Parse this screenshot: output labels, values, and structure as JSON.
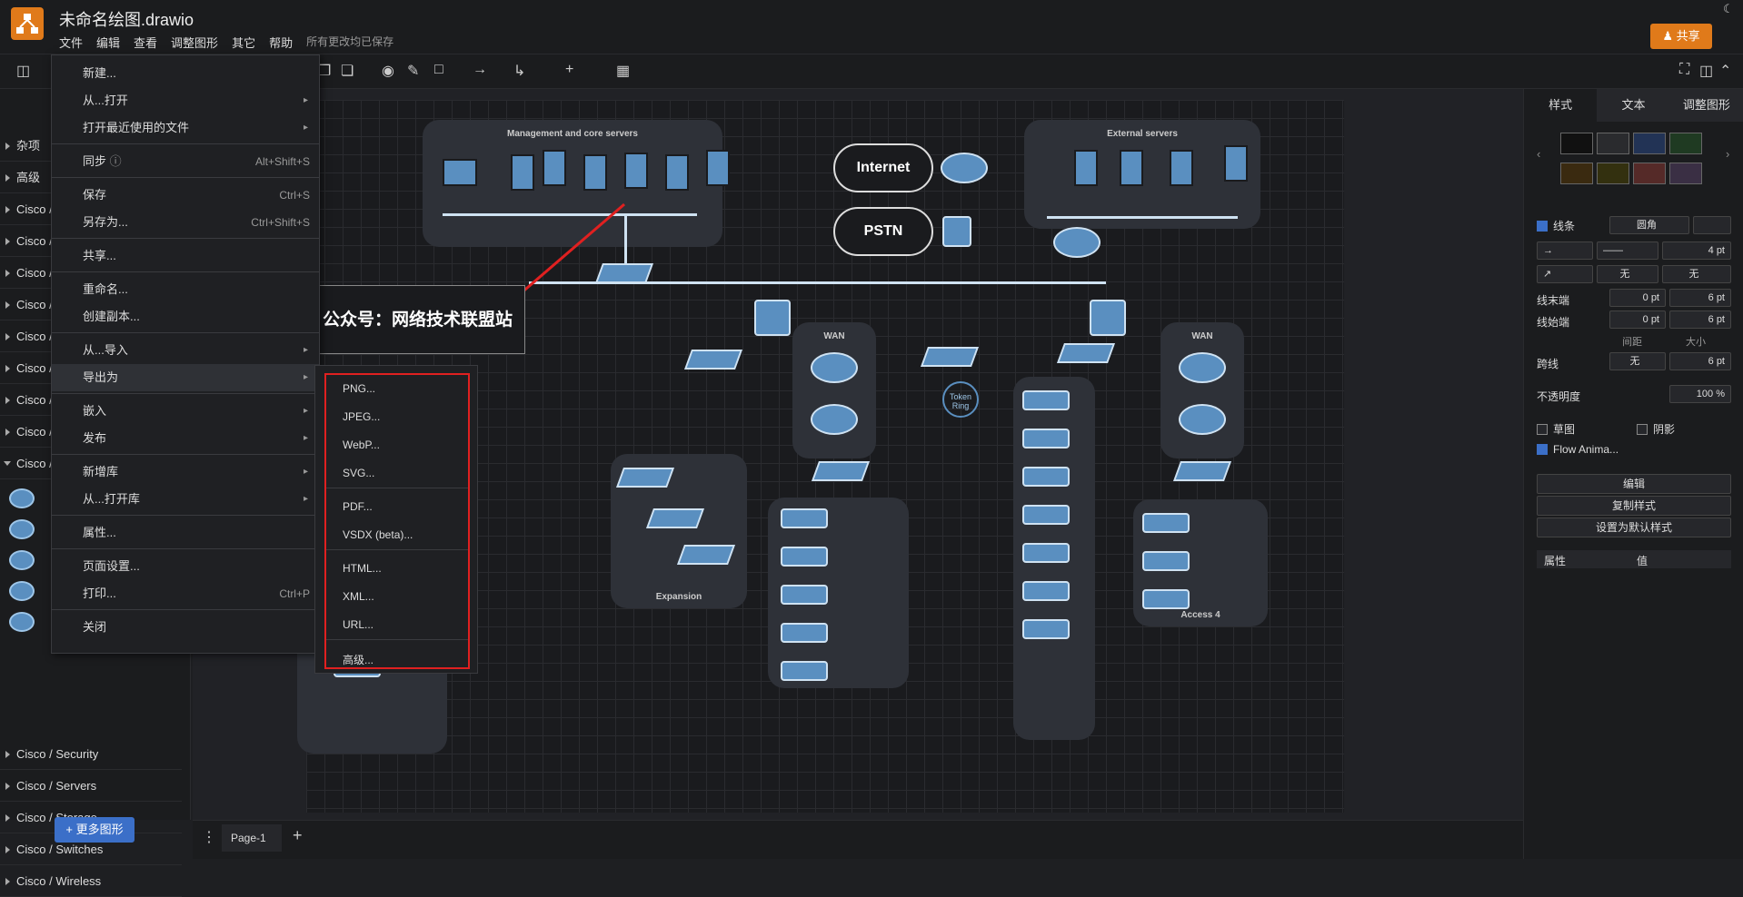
{
  "app": {
    "title": "未命名绘图.drawio",
    "menus": [
      "文件",
      "编辑",
      "查看",
      "调整图形",
      "其它",
      "帮助"
    ],
    "saved_status": "所有更改均已保存",
    "share_label": "共享"
  },
  "sidebar": {
    "items": [
      {
        "label": "杂项",
        "open": false
      },
      {
        "label": "高级",
        "open": false
      },
      {
        "label": "Cisco /",
        "open": false
      },
      {
        "label": "Cisco /",
        "open": false
      },
      {
        "label": "Cisco /",
        "open": false
      },
      {
        "label": "Cisco /",
        "open": false
      },
      {
        "label": "Cisco /",
        "open": false
      },
      {
        "label": "Cisco /",
        "open": false
      },
      {
        "label": "Cisco /",
        "open": false
      },
      {
        "label": "Cisco /",
        "open": false
      },
      {
        "label": "Cisco /",
        "open": true
      }
    ],
    "bottom_items": [
      "Cisco / Security",
      "Cisco / Servers",
      "Cisco / Storage",
      "Cisco / Switches",
      "Cisco / Wireless"
    ],
    "more_shapes": "+ 更多图形"
  },
  "file_menu": {
    "items": [
      {
        "label": "新建...",
        "shortcut": "",
        "arrow": false
      },
      {
        "label": "从...打开",
        "shortcut": "",
        "arrow": true
      },
      {
        "label": "打开最近使用的文件",
        "shortcut": "",
        "arrow": true
      },
      {
        "label": "同步",
        "shortcut": "Alt+Shift+S",
        "arrow": false
      },
      {
        "label": "保存",
        "shortcut": "Ctrl+S",
        "arrow": false
      },
      {
        "label": "另存为...",
        "shortcut": "Ctrl+Shift+S",
        "arrow": false
      },
      {
        "label": "共享...",
        "shortcut": "",
        "arrow": false
      },
      {
        "label": "重命名...",
        "shortcut": "",
        "arrow": false
      },
      {
        "label": "创建副本...",
        "shortcut": "",
        "arrow": false
      },
      {
        "label": "从...导入",
        "shortcut": "",
        "arrow": true
      },
      {
        "label": "导出为",
        "shortcut": "",
        "arrow": true
      },
      {
        "label": "嵌入",
        "shortcut": "",
        "arrow": true
      },
      {
        "label": "发布",
        "shortcut": "",
        "arrow": true
      },
      {
        "label": "新增库",
        "shortcut": "",
        "arrow": true
      },
      {
        "label": "从...打开库",
        "shortcut": "",
        "arrow": true
      },
      {
        "label": "属性...",
        "shortcut": "",
        "arrow": false
      },
      {
        "label": "页面设置...",
        "shortcut": "",
        "arrow": false
      },
      {
        "label": "打印...",
        "shortcut": "Ctrl+P",
        "arrow": false
      },
      {
        "label": "关闭",
        "shortcut": "",
        "arrow": false
      }
    ]
  },
  "export_menu": {
    "items": [
      "PNG...",
      "JPEG...",
      "WebP...",
      "SVG...",
      "PDF...",
      "VSDX (beta)...",
      "HTML...",
      "XML...",
      "URL...",
      "高级..."
    ]
  },
  "diagram": {
    "watermark": "公众号：网络技术联盟站",
    "groups": {
      "management": "Management and core servers",
      "external": "External servers",
      "wan1": "WAN",
      "wan2": "WAN",
      "expansion": "Expansion",
      "access4": "Access 4"
    },
    "clouds": {
      "internet": "Internet",
      "pstn": "PSTN"
    },
    "token_ring": "Token Ring"
  },
  "right_panel": {
    "tabs": [
      "样式",
      "文本",
      "调整图形"
    ],
    "swatch_colors": [
      "#111111",
      "#2a2b2e",
      "#223355",
      "#1f3a22",
      "#3a2a10",
      "#33300f",
      "#552a28",
      "#3a2f44"
    ],
    "line_label": "线条",
    "line_style": "圆角",
    "line_width": "4 pt",
    "arrow_none1": "无",
    "arrow_none2": "无",
    "line_end": "线末端",
    "line_start": "线始端",
    "end_spacing": "0 pt",
    "end_size": "6 pt",
    "start_spacing": "0 pt",
    "start_size": "6 pt",
    "spacing_label": "间距",
    "size_label": "大小",
    "jump_label": "跨线",
    "jump_value": "无",
    "jump_size": "6 pt",
    "opacity_label": "不透明度",
    "opacity_value": "100 %",
    "sketch_label": "草图",
    "shadow_label": "阴影",
    "flow_label": "Flow Anima...",
    "edit_label": "编辑",
    "copy_style": "复制样式",
    "set_default": "设置为默认样式",
    "prop_label": "属性",
    "value_label": "值"
  },
  "bottom": {
    "page_tab": "Page-1"
  }
}
